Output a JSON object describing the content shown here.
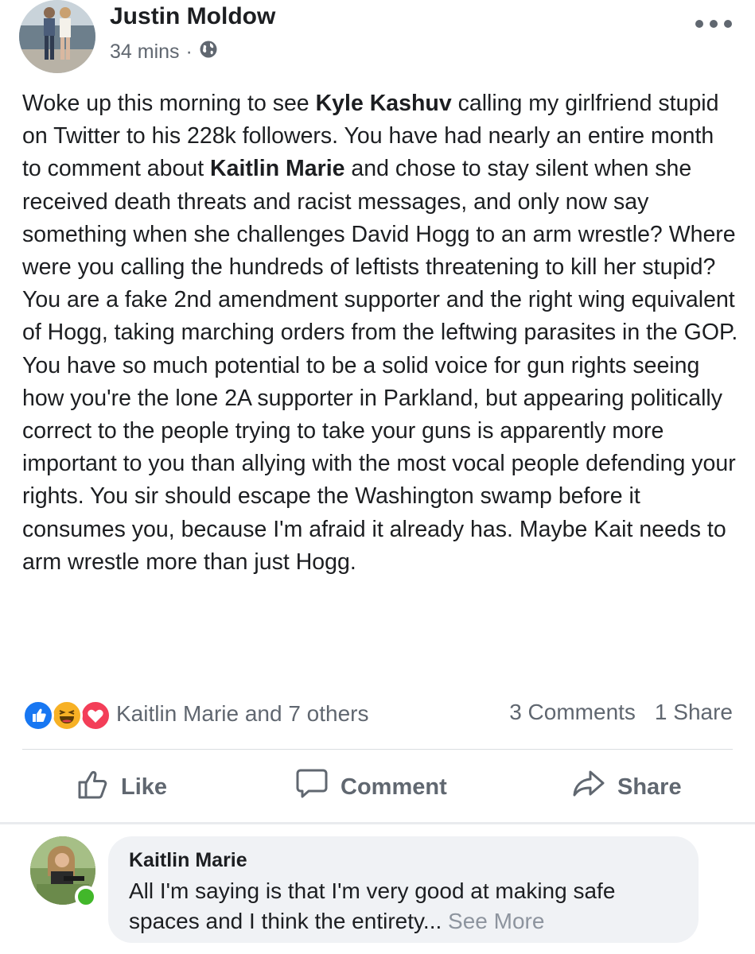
{
  "post": {
    "author": "Justin Moldow",
    "timestamp": "34 mins",
    "separator": "·",
    "privacy_icon": "globe-icon",
    "more_icon": "more-horizontal-icon",
    "body": {
      "p1": "Woke up this morning to see ",
      "mention1": "Kyle Kashuv",
      "p2": " calling my girlfriend stupid on Twitter to his 228k followers. You have had nearly an entire month to comment about ",
      "mention2": "Kaitlin Marie",
      "p3": " and chose to stay silent when she received death threats and racist messages, and only now say something when she challenges David Hogg to an arm wrestle? Where were you calling the hundreds of leftists threatening to kill her stupid? You are a fake 2nd amendment supporter and the right wing equivalent of Hogg, taking marching orders from the leftwing parasites in the GOP. You have so much potential to be a solid voice for gun rights seeing how you're the lone 2A supporter in Parkland, but appearing politically correct to the people trying to take your guns is apparently more important to you than allying with the most vocal people defending your rights. You sir should escape the Washington swamp before it consumes you, because I'm afraid it already has. Maybe Kait needs to arm wrestle more than just Hogg."
    },
    "reactions": {
      "icons": [
        "like-icon",
        "haha-icon",
        "love-icon"
      ],
      "label": "Kaitlin Marie and 7 others",
      "comments": "3 Comments",
      "shares": "1 Share"
    },
    "actions": {
      "like": "Like",
      "comment": "Comment",
      "share": "Share"
    }
  },
  "comment": {
    "author": "Kaitlin Marie",
    "text": "All I'm saying is that I'm very good at making safe spaces and I think the entirety...",
    "see_more": "See More"
  },
  "colors": {
    "text": "#1c1e21",
    "secondary": "#606770",
    "like_blue": "#1877f2",
    "love_red": "#f33e58",
    "haha_yellow": "#f7b125",
    "online_green": "#42b72a"
  }
}
